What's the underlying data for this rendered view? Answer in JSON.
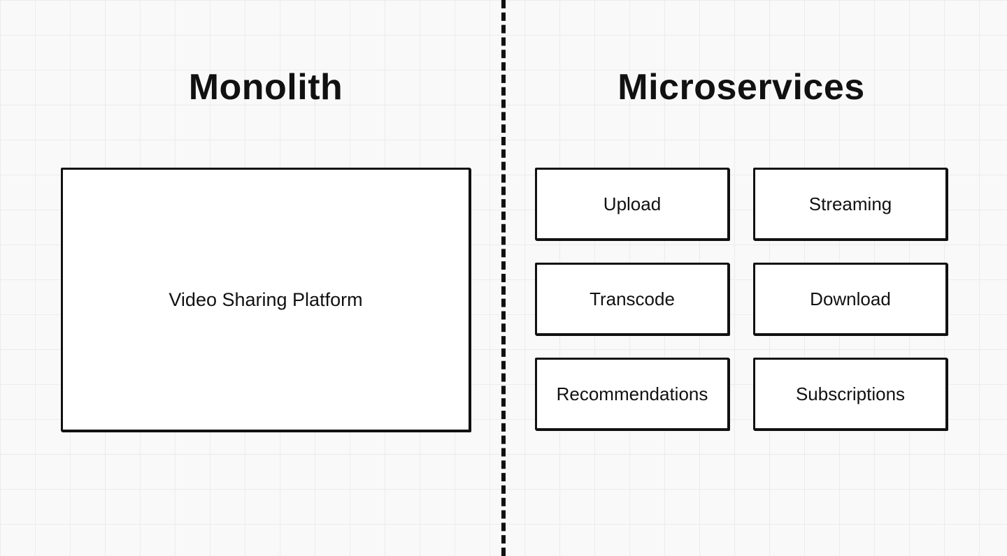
{
  "left": {
    "title": "Monolith",
    "box_label": "Video Sharing Platform"
  },
  "right": {
    "title": "Microservices",
    "services": [
      "Upload",
      "Streaming",
      "Transcode",
      "Download",
      "Recommendations",
      "Subscriptions"
    ]
  }
}
